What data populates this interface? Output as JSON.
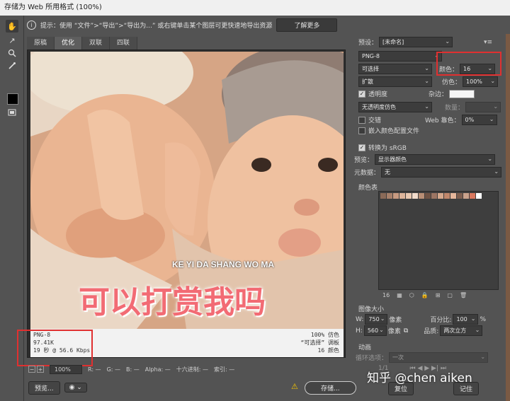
{
  "window": {
    "title": "存储为 Web 所用格式 (100%)"
  },
  "hint": {
    "text": "提示：使用 “文件”>“导出”>“导出为...” 或右键单击某个图层可更快速地导出资源",
    "learn_more": "了解更多"
  },
  "tabs": [
    "原稿",
    "优化",
    "双联",
    "四联"
  ],
  "image_caption": {
    "pinyin": "KE YI DA SHANG WO MA",
    "chinese": "可以打赏我吗"
  },
  "info": {
    "format": "PNG-8",
    "size": "97.41K",
    "time": "19 秒 @ 56.6 Kbps",
    "dither": "100% 仿色",
    "palette": "“可选择” 调板",
    "colors": "16 颜色"
  },
  "status": {
    "zoom": "100%",
    "r": "R: —",
    "g": "G: —",
    "b": "B: —",
    "alpha": "Alpha: —",
    "hex": "十六进制: —",
    "index": "索引: —"
  },
  "bottom": {
    "preview": "预览...",
    "save": "存储...",
    "reset": "复位",
    "done": "记住"
  },
  "settings": {
    "preset_label": "预设：",
    "preset_value": "[未命名]",
    "format": "PNG-8",
    "reduction": "可选择",
    "colors_label": "颜色：",
    "colors_value": "16",
    "dither_algo": "扩散",
    "dither_label": "仿色：",
    "dither_value": "100%",
    "transparency_label": "透明度",
    "matte_label": "杂边：",
    "trans_dither": "无透明度仿色",
    "amount_label": "数量：",
    "interlaced_label": "交错",
    "web_snap_label": "Web 靠色：",
    "web_snap_value": "0%",
    "embed_profile_label": "嵌入颜色配置文件",
    "convert_srgb_label": "转换为 sRGB",
    "preview_label": "预览：",
    "preview_value": "显示器颜色",
    "metadata_label": "元数据：",
    "metadata_value": "无",
    "color_table_label": "颜色表",
    "color_count": "16",
    "image_size_label": "图像大小",
    "w_label": "W:",
    "w_value": "750",
    "h_label": "H:",
    "h_value": "560",
    "px_label": "像素",
    "percent_label": "百分比:",
    "percent_value": "100",
    "percent_unit": "%",
    "quality_label": "品质:",
    "quality_value": "两次立方",
    "animation_label": "动画",
    "loop_label": "循环选项：",
    "loop_value": "一次",
    "frame_value": "1/1"
  },
  "palette_colors": [
    "#8a6a58",
    "#a7806a",
    "#c79a80",
    "#dcb49a",
    "#e9c8b0",
    "#f3dccb",
    "#b88e75",
    "#6e5244",
    "#9c7563",
    "#d5a88c",
    "#c0876b",
    "#e6b79b",
    "#7d5e4f",
    "#caa28b",
    "#d9785f",
    "#ffffff"
  ],
  "watermark": "知乎 @chen aiken"
}
